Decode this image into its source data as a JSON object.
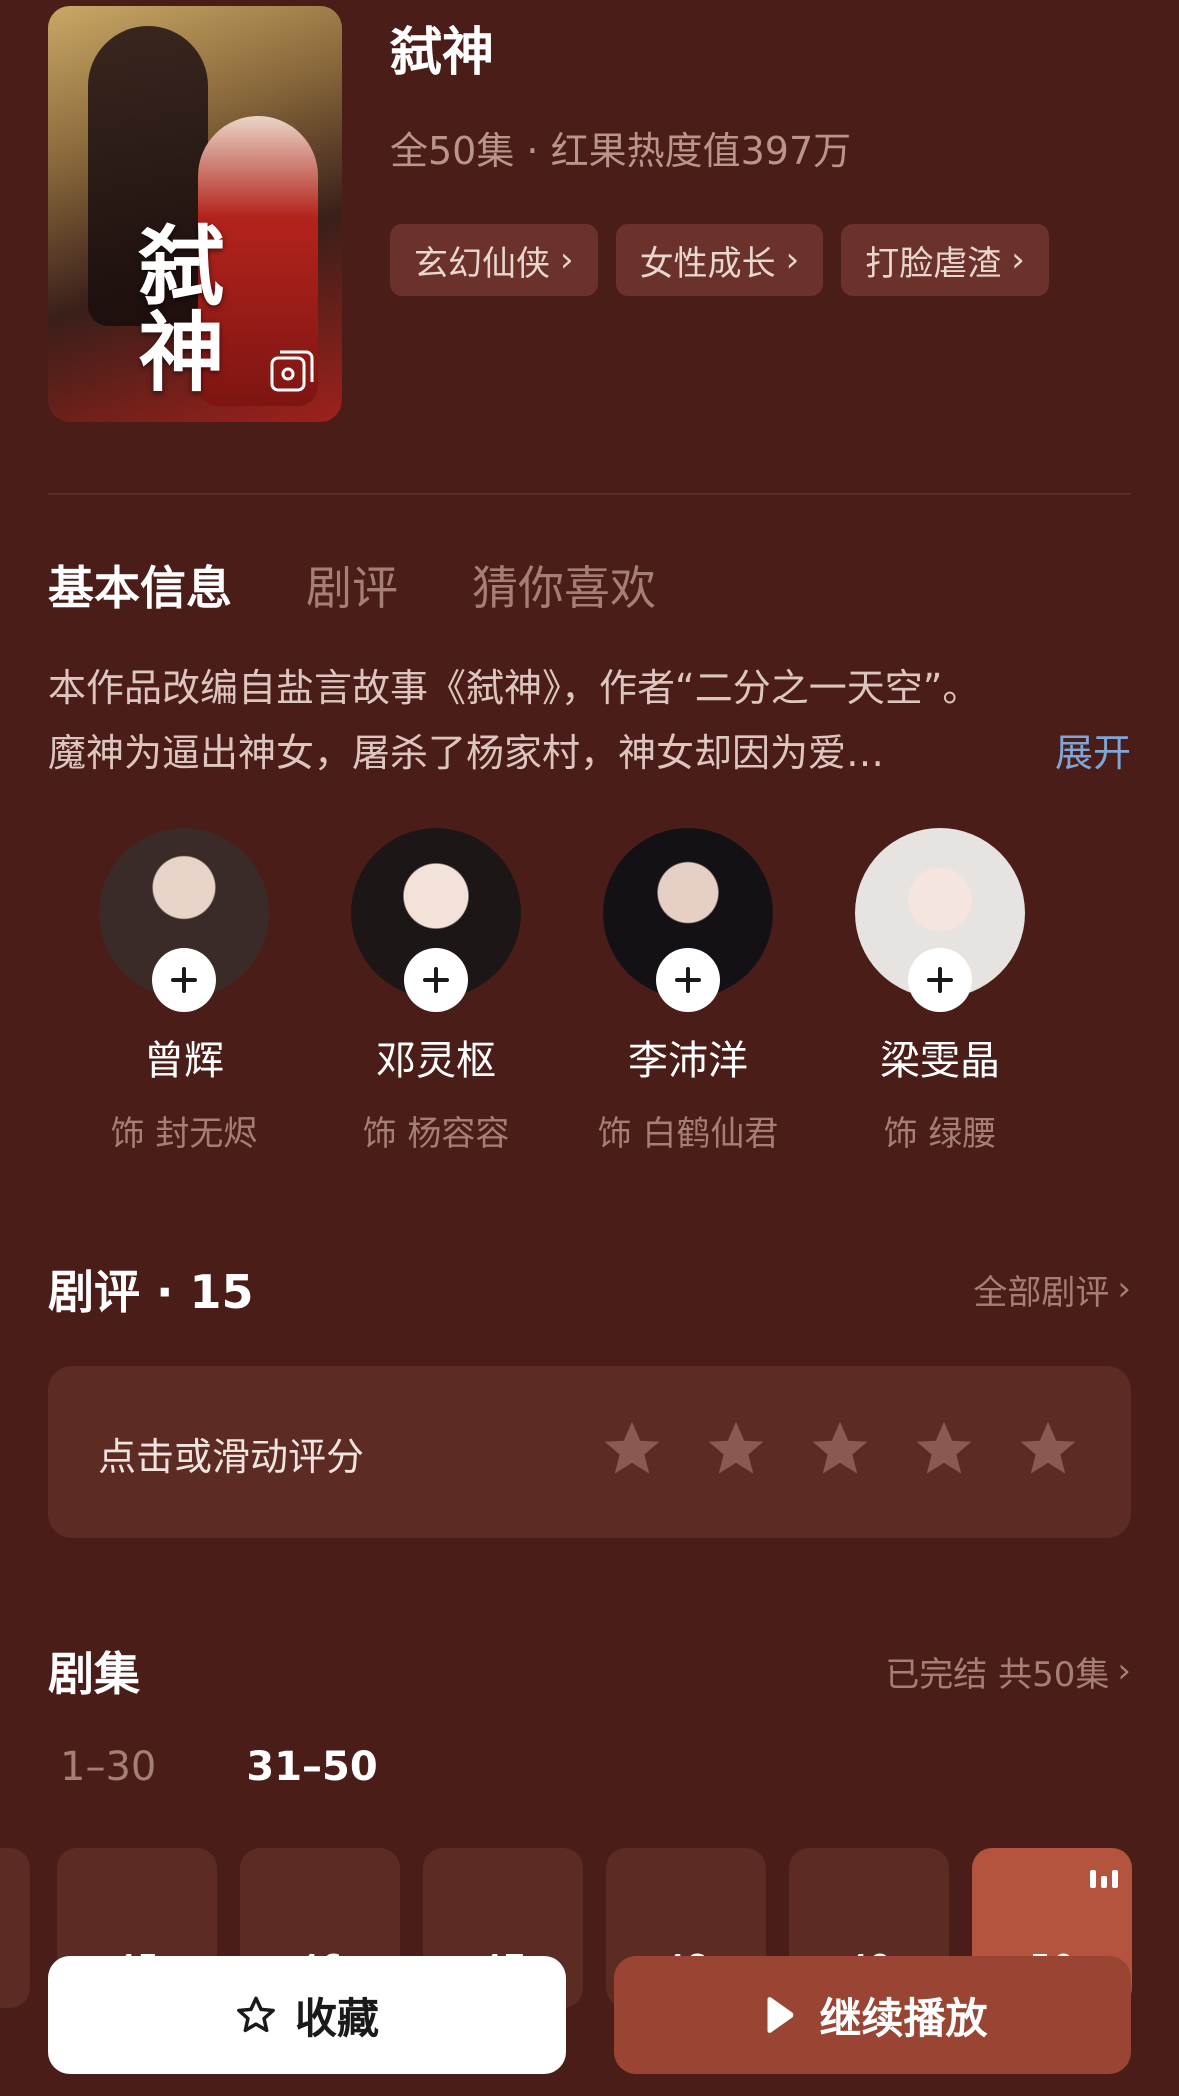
{
  "drama": {
    "title": "弑神",
    "poster_title": "弑神",
    "meta": "全50集 · 红果热度值397万",
    "tags": [
      "玄幻仙侠",
      "女性成长",
      "打脸虐渣"
    ]
  },
  "tabs": [
    "基本信息",
    "剧评",
    "猜你喜欢"
  ],
  "description": {
    "line1": "本作品改编自盐言故事《弑神》，作者“二分之一天空”。",
    "line2": "魔神为逼出神女，屠杀了杨家村，神女却因为爱…",
    "expand": "展开"
  },
  "cast": [
    {
      "name": "曾辉",
      "role": "饰 封无烬"
    },
    {
      "name": "邓灵枢",
      "role": "饰 杨容容"
    },
    {
      "name": "李沛洋",
      "role": "饰 白鹤仙君"
    },
    {
      "name": "梁雯晶",
      "role": "饰 绿腰"
    }
  ],
  "reviews": {
    "title": "剧评 · 15",
    "link": "全部剧评",
    "rating_hint": "点击或滑动评分",
    "star_count": 5
  },
  "episodes": {
    "title": "剧集",
    "status": "已完结 共50集",
    "ranges": [
      "1–30",
      "31–50"
    ],
    "active_range": "31–50",
    "visible": [
      "45",
      "46",
      "47",
      "48",
      "49",
      "50"
    ],
    "playing": "50"
  },
  "actions": {
    "favorite": "收藏",
    "continue": "继续播放"
  },
  "colors": {
    "background": "#4a1d18",
    "card": "#5b2b24",
    "accent": "#9a4533",
    "link_blue": "#7ea6d6"
  }
}
